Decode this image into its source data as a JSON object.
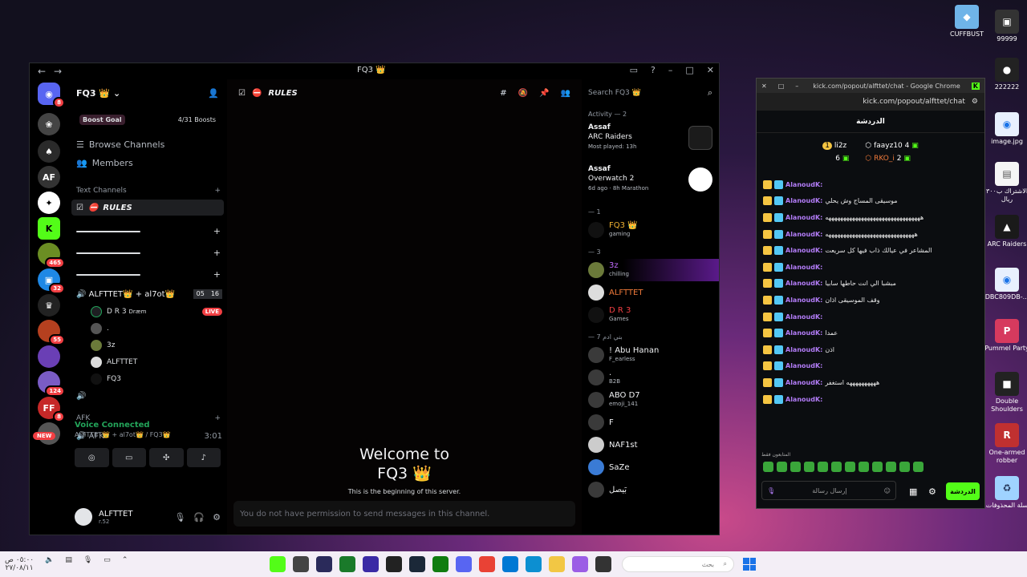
{
  "desktop": {
    "icons": [
      {
        "label": "CUFFBUST",
        "color": "#6fb4e8"
      },
      {
        "label": "99999",
        "color": "#333333"
      },
      {
        "label": "222222",
        "color": "#222222"
      },
      {
        "label": "image.jpg",
        "color": "#e8f0fe"
      },
      {
        "label": "الاشتراك ب٣٠٠ ريال",
        "color": "#f5f5f5"
      },
      {
        "label": "ARC Raiders",
        "color": "#1a1a1a"
      },
      {
        "label": "DBC809DB-...",
        "color": "#e8f0fe"
      },
      {
        "label": "Pummel Party",
        "color": "#d63a5e"
      },
      {
        "label": "Double Shoulders",
        "color": "#222222"
      },
      {
        "label": "One-armed robber",
        "color": "#c03030"
      },
      {
        "label": "سلة المحذوفات",
        "color": "#9fd3ff"
      }
    ]
  },
  "discord": {
    "window_title": "FQ3 👑",
    "server_name": "FQ3 👑",
    "boost": {
      "label": "Boost Goal",
      "progress": "4/31 Boosts"
    },
    "nav": {
      "browse": "Browse Channels",
      "members": "Members"
    },
    "text_category": "Text Channels",
    "active_channel": "RULES",
    "voice_channel": {
      "name": "ALFTTET👑 + al7ot👑",
      "count_a": "05",
      "count_b": "16"
    },
    "voice_users": [
      {
        "name": "D R 3",
        "tag": "Dræm",
        "live": "LIVE"
      },
      {
        "name": "."
      },
      {
        "name": "3z"
      },
      {
        "name": "ALFTTET"
      },
      {
        "name": "FQ3"
      }
    ],
    "afk_category": "AFK",
    "afk_channel": {
      "name": "AFK",
      "time": "3:01"
    },
    "voice_panel": {
      "title": "Voice Connected",
      "subtitle": "ALFTTET👑 + al7ot👑 / FQ3👑"
    },
    "user": {
      "name": "ALFTTET",
      "status": "r.52"
    },
    "welcome": {
      "title_line1": "Welcome to",
      "title_line2": "FQ3 👑",
      "subtitle": "This is the beginning of this server."
    },
    "composer_placeholder": "You do not have permission to send messages in this channel.",
    "search_placeholder": "Search FQ3 👑",
    "activity_header": "Activity — 2",
    "activities": [
      {
        "user": "Assaf",
        "game": "ARC Raiders",
        "detail": "Most played: 13h",
        "color": "#1b1b1b"
      },
      {
        "user": "Assaf",
        "game": "Overwatch 2",
        "detail": "6d ago · 8h Marathon",
        "color": "#ffffff"
      }
    ],
    "group_1": "— 1",
    "group_1_members": [
      {
        "name": "FQ3 👑",
        "status": "gaming"
      }
    ],
    "group_2": "— 3",
    "group_2_members": [
      {
        "name": "3z",
        "status": "chilling"
      },
      {
        "name": "ALFTTET",
        "status": ""
      },
      {
        "name": "D R 3",
        "status": "Games"
      }
    ],
    "group_3": "— بني ادم 7",
    "group_3_members": [
      {
        "name": "! Abu Hanan",
        "status": "F_earless"
      },
      {
        "name": ".",
        "status": "B2B"
      },
      {
        "name": "ABO D7",
        "status": "emoji_141"
      },
      {
        "name": "F",
        "status": ""
      },
      {
        "name": "NAF1st",
        "status": ""
      },
      {
        "name": "SaZe",
        "status": ""
      },
      {
        "name": "بَيصل",
        "status": ""
      }
    ]
  },
  "kick": {
    "window_title": "kick.com/popout/alfttet/chat - Google Chrome",
    "address": "kick.com/popout/alfttet/chat",
    "chat_title": "الدردشة",
    "leaders": [
      {
        "rank": "1",
        "name": "li2z",
        "value": "6"
      },
      {
        "rank": "",
        "name": "faayz10",
        "value": "4"
      },
      {
        "rank": "",
        "name": "RKO_i",
        "value": "2"
      }
    ],
    "messages": [
      {
        "user": "AlanoudK:",
        "text": ""
      },
      {
        "user": "AlanoudK:",
        "text": "موسيقى المساج وش يحلي"
      },
      {
        "user": "AlanoudK:",
        "text": "ههههههههههههههههههههههههههههههههه"
      },
      {
        "user": "AlanoudK:",
        "text": "ههههههههههههههههههههههههههههههه"
      },
      {
        "user": "AlanoudK:",
        "text": "المشاعر في عيالك ذاب فيها كل سريعت"
      },
      {
        "user": "AlanoudK:",
        "text": ""
      },
      {
        "user": "AlanoudK:",
        "text": "مبشبا الي انت حاطها سابيا"
      },
      {
        "user": "AlanoudK:",
        "text": "وقف الموسيقى اذان"
      },
      {
        "user": "AlanoudK:",
        "text": ""
      },
      {
        "user": "AlanoudK:",
        "text": "عمدا"
      },
      {
        "user": "AlanoudK:",
        "text": "اذن"
      },
      {
        "user": "AlanoudK:",
        "text": ""
      },
      {
        "user": "AlanoudK:",
        "text": "ههههههههههه استغفر"
      },
      {
        "user": "AlanoudK:",
        "text": ""
      }
    ],
    "subs_label": "المتابعون فقط",
    "input_placeholder": "إرسال رسالة",
    "send_label": "الدردشة"
  },
  "taskbar": {
    "time": "٠٥:٠٠ ص",
    "date": "٢٧/٠٨/١١",
    "search_placeholder": "بحث"
  }
}
